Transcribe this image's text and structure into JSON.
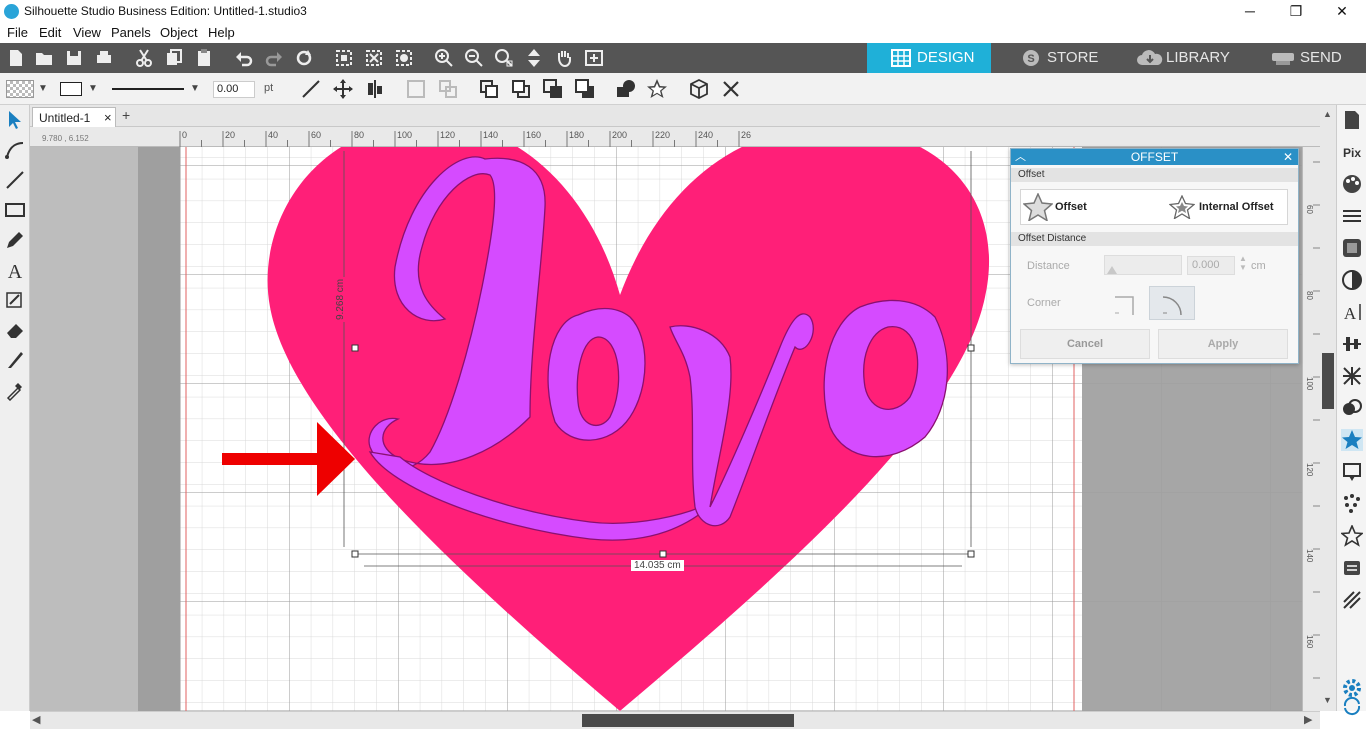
{
  "window": {
    "title": "Silhouette Studio Business Edition: Untitled-1.studio3",
    "minimize": "─",
    "restore": "❐",
    "close": "✕"
  },
  "menu": [
    "File",
    "Edit",
    "View",
    "Panels",
    "Object",
    "Help"
  ],
  "mode_tabs": {
    "design": "DESIGN",
    "store": "STORE",
    "library": "LIBRARY",
    "send": "SEND"
  },
  "line_toolbar": {
    "line_width_value": "0.00",
    "line_width_unit": "pt"
  },
  "document": {
    "tab_label": "Untitled-1",
    "tab_close": "×",
    "add_tab": "+",
    "cursor_coords": "9.780 , 6.152"
  },
  "ruler": {
    "top_ticks": [
      "0",
      "20",
      "40",
      "60",
      "80",
      "100",
      "120",
      "140",
      "160",
      "180",
      "200",
      "220",
      "240",
      "26"
    ],
    "right_ticks": [
      "60",
      "80",
      "100",
      "120",
      "140",
      "160"
    ]
  },
  "selection": {
    "height_label": "9.268 cm",
    "width_label": "14.035 cm"
  },
  "offset_panel": {
    "title": "OFFSET",
    "section_offset": "Offset",
    "offset_button": "Offset",
    "internal_offset_button": "Internal Offset",
    "section_distance": "Offset Distance",
    "distance_label": "Distance",
    "distance_value": "0.000",
    "distance_unit": "cm",
    "corner_label": "Corner",
    "cancel_button": "Cancel",
    "apply_button": "Apply"
  },
  "artwork": {
    "word": "love",
    "heart_color": "#ff1f78",
    "letters_color": "#d54bff",
    "arrow_color": "#ee0000"
  },
  "colors": {
    "accent": "#2aa4d8",
    "active_tab": "#1fb0d8",
    "toolbar_dark": "#555555"
  }
}
